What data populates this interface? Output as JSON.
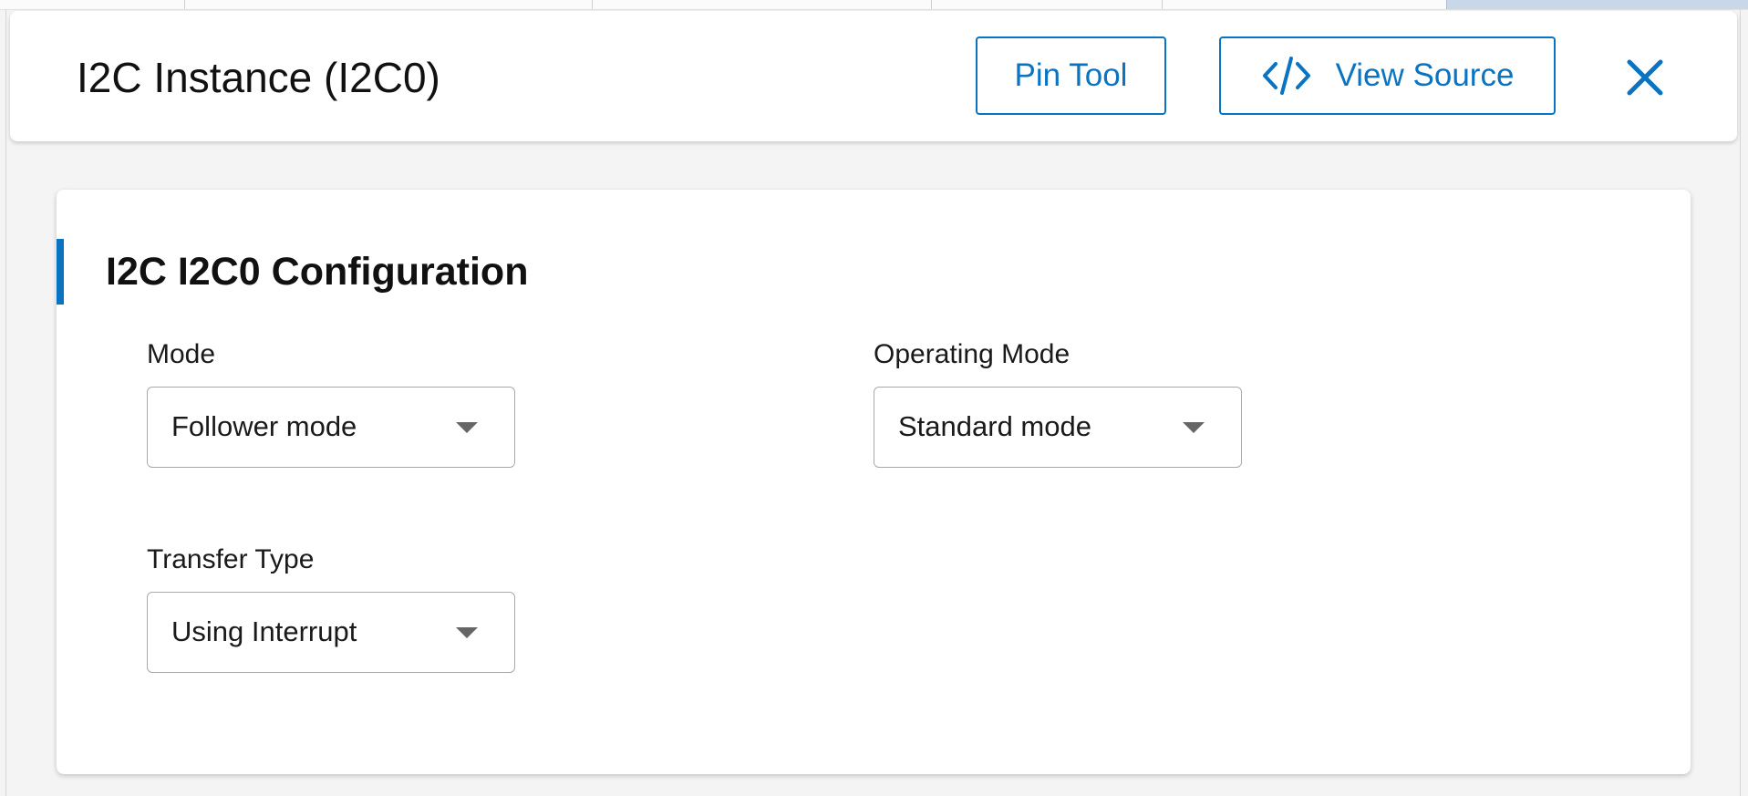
{
  "colors": {
    "accent": "#0a74c2",
    "caret": "#666666",
    "border": "#a9a9a9"
  },
  "header": {
    "title": "I2C Instance (I2C0)",
    "pin_tool_label": "Pin Tool",
    "view_source_label": "View Source",
    "view_source_icon": "code-icon",
    "close_icon": "close-icon"
  },
  "config": {
    "section_title": "I2C I2C0 Configuration",
    "fields": {
      "mode": {
        "label": "Mode",
        "value": "Follower mode"
      },
      "operating_mode": {
        "label": "Operating Mode",
        "value": "Standard mode"
      },
      "transfer_type": {
        "label": "Transfer Type",
        "value": "Using Interrupt"
      }
    }
  }
}
